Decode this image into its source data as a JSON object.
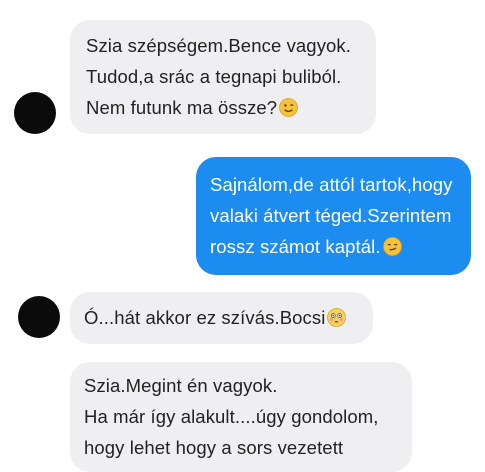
{
  "conversation": {
    "messages": [
      {
        "direction": "incoming",
        "lines": [
          "Szia szépségem.Bence vagyok.",
          "Tudod,a srác a tegnapi buliból.",
          "Nem futunk ma össze?"
        ],
        "emoji": "winking-face-icon"
      },
      {
        "direction": "outgoing",
        "lines": [
          "Sajnálom,de attól tartok,hogy",
          "valaki átvert téged.Szerintem",
          "rossz számot kaptál."
        ],
        "emoji": "smirking-face-icon"
      },
      {
        "direction": "incoming",
        "lines": [
          "Ó...hát akkor ez szívás.Bocsi"
        ],
        "emoji": "flushed-face-icon"
      },
      {
        "direction": "incoming",
        "lines": [
          "Szia.Megint én vagyok.",
          "Ha már így alakult....úgy gondolom,",
          "hogy lehet hogy a sors vezetett"
        ]
      }
    ]
  },
  "colors": {
    "incoming_bubble": "#efeff1",
    "outgoing_bubble": "#1d8cf0",
    "avatar": "#0b0b0b",
    "emoji_yellow": "#f6c23a"
  }
}
